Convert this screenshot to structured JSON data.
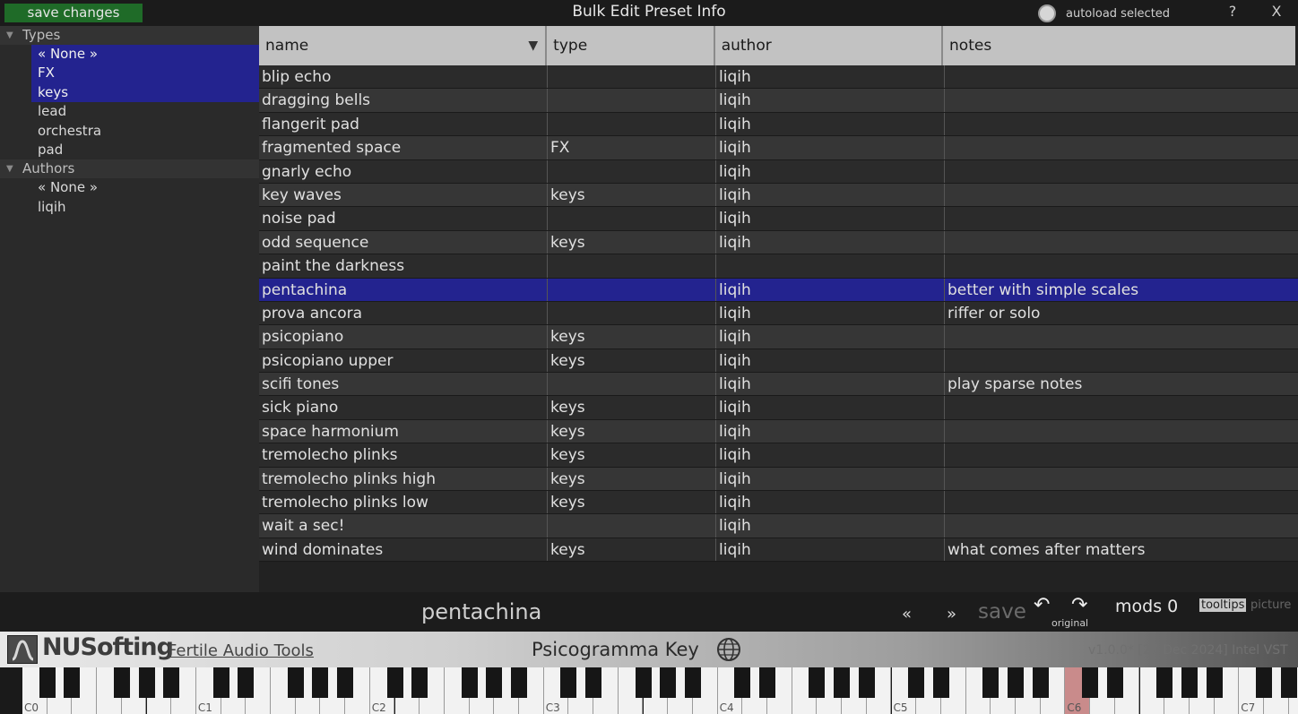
{
  "header": {
    "save_changes": "save changes",
    "title": "Bulk Edit Preset Info",
    "autoload_label": "autoload selected",
    "help": "?",
    "close": "X"
  },
  "sidebar": {
    "types_label": "Types",
    "types": [
      {
        "label": "« None »",
        "selected": true
      },
      {
        "label": "FX",
        "selected": true
      },
      {
        "label": "keys",
        "selected": true
      },
      {
        "label": "lead",
        "selected": false
      },
      {
        "label": "orchestra",
        "selected": false
      },
      {
        "label": "pad",
        "selected": false
      }
    ],
    "authors_label": "Authors",
    "authors": [
      {
        "label": "« None »",
        "selected": false
      },
      {
        "label": "liqih",
        "selected": false
      }
    ]
  },
  "table": {
    "columns": [
      "name",
      "type",
      "author",
      "notes"
    ],
    "selected_index": 9,
    "rows": [
      {
        "name": "blip echo",
        "type": "",
        "author": "liqih",
        "notes": ""
      },
      {
        "name": "dragging bells",
        "type": "",
        "author": "liqih",
        "notes": ""
      },
      {
        "name": "flangerit pad",
        "type": "",
        "author": "liqih",
        "notes": ""
      },
      {
        "name": "fragmented space",
        "type": "FX",
        "author": "liqih",
        "notes": ""
      },
      {
        "name": "gnarly echo",
        "type": "",
        "author": "liqih",
        "notes": ""
      },
      {
        "name": "key waves",
        "type": "keys",
        "author": "liqih",
        "notes": ""
      },
      {
        "name": "noise pad",
        "type": "",
        "author": "liqih",
        "notes": ""
      },
      {
        "name": "odd sequence",
        "type": "keys",
        "author": "liqih",
        "notes": ""
      },
      {
        "name": "paint the darkness",
        "type": "",
        "author": "",
        "notes": ""
      },
      {
        "name": "pentachina",
        "type": "",
        "author": "liqih",
        "notes": "better with simple scales"
      },
      {
        "name": "prova ancora",
        "type": "",
        "author": "liqih",
        "notes": "riffer or solo"
      },
      {
        "name": "psicopiano",
        "type": "keys",
        "author": "liqih",
        "notes": ""
      },
      {
        "name": "psicopiano upper",
        "type": "keys",
        "author": "liqih",
        "notes": ""
      },
      {
        "name": "scifi tones",
        "type": "",
        "author": "liqih",
        "notes": "play sparse notes"
      },
      {
        "name": "sick piano",
        "type": "keys",
        "author": "liqih",
        "notes": ""
      },
      {
        "name": "space harmonium",
        "type": "keys",
        "author": "liqih",
        "notes": ""
      },
      {
        "name": "tremolecho plinks",
        "type": "keys",
        "author": "liqih",
        "notes": ""
      },
      {
        "name": "tremolecho plinks high",
        "type": "keys",
        "author": "liqih",
        "notes": ""
      },
      {
        "name": "tremolecho plinks low",
        "type": "keys",
        "author": "liqih",
        "notes": ""
      },
      {
        "name": "wait a sec!",
        "type": "",
        "author": "liqih",
        "notes": ""
      },
      {
        "name": "wind dominates",
        "type": "keys",
        "author": "liqih",
        "notes": "what comes after matters"
      }
    ]
  },
  "bottom": {
    "preset_name": "pentachina",
    "prev": "«",
    "next": "»",
    "save": "save",
    "undo": "↶",
    "redo": "↷",
    "original": "original",
    "mods": "mods 0",
    "tooltips": "tooltips",
    "picture": "picture"
  },
  "brand": {
    "name": "NUSofting",
    "tagline": "Fertile Audio Tools",
    "product": "Psicogramma Key",
    "version": "v1.0.0* [27 Dec 2024] Intel VST"
  },
  "keyboard": {
    "labels": [
      "C0",
      "C1",
      "C2",
      "C3",
      "C4",
      "C5",
      "C6",
      "C7"
    ],
    "highlight_octave": 6
  }
}
